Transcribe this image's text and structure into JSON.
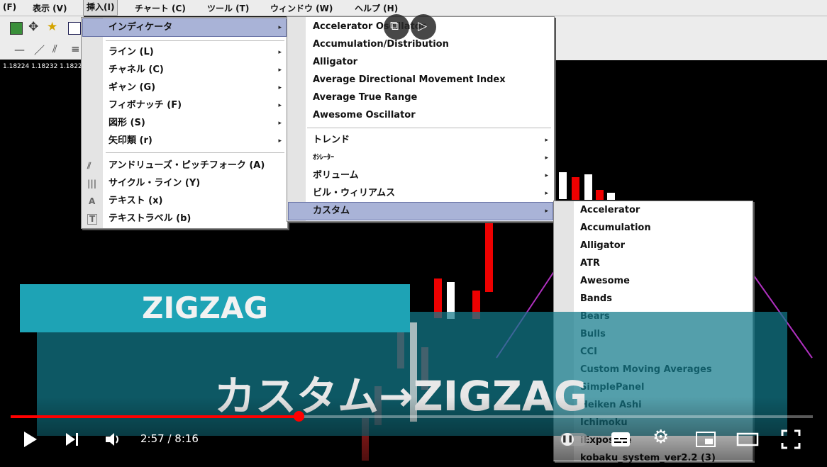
{
  "menubar": {
    "items": [
      "(F)",
      "表示 (V)",
      "挿入(I)",
      "チャート (C)",
      "ツール (T)",
      "ウィンドウ (W)",
      "ヘルプ (H)"
    ]
  },
  "price_row": "1.18224 1.18232 1.1822",
  "insert_menu": {
    "items": [
      {
        "label": "インディケータ",
        "submenu": true
      },
      {
        "label": "ライン (L)",
        "submenu": true
      },
      {
        "label": "チャネル (C)",
        "submenu": true
      },
      {
        "label": "ギャン (G)",
        "submenu": true
      },
      {
        "label": "フィボナッチ (F)",
        "submenu": true
      },
      {
        "label": "図形 (S)",
        "submenu": true
      },
      {
        "label": "矢印類 (r)",
        "submenu": true
      },
      {
        "label": "アンドリューズ・ピッチフォーク (A)",
        "submenu": false
      },
      {
        "label": "サイクル・ライン (Y)",
        "submenu": false
      },
      {
        "label": "テキスト (x)",
        "submenu": false
      },
      {
        "label": "テキストラベル (b)",
        "submenu": false
      }
    ]
  },
  "indicator_menu": {
    "items": [
      "Accelerator Oscillator",
      "Accumulation/Distribution",
      "Alligator",
      "Average Directional Movement Index",
      "Average True Range",
      "Awesome Oscillator"
    ],
    "groups": [
      "トレンド",
      "ｵｼﾚｰﾀｰ",
      "ボリューム",
      "ビル・ウィリアムス",
      "カスタム"
    ]
  },
  "custom_menu": {
    "items": [
      "Accelerator",
      "Accumulation",
      "Alligator",
      "ATR",
      "Awesome",
      "Bands",
      "Bears",
      "Bulls",
      "CCI",
      "Custom Moving Averages",
      "SimplePanel",
      "Heiken Ashi",
      "Ichimoku",
      "iExposure",
      "kobaku_system_ver2.2 (3)"
    ]
  },
  "overlay": {
    "banner": "ZIGZAG",
    "caption": "カスタム→ZIGZAG"
  },
  "player": {
    "time": "2:57 / 8:16",
    "progress": 0.359
  },
  "colors": {
    "accent": "#ff0000",
    "teal": "#1ea3b5",
    "menu_highlight": "#a9b3d7"
  }
}
